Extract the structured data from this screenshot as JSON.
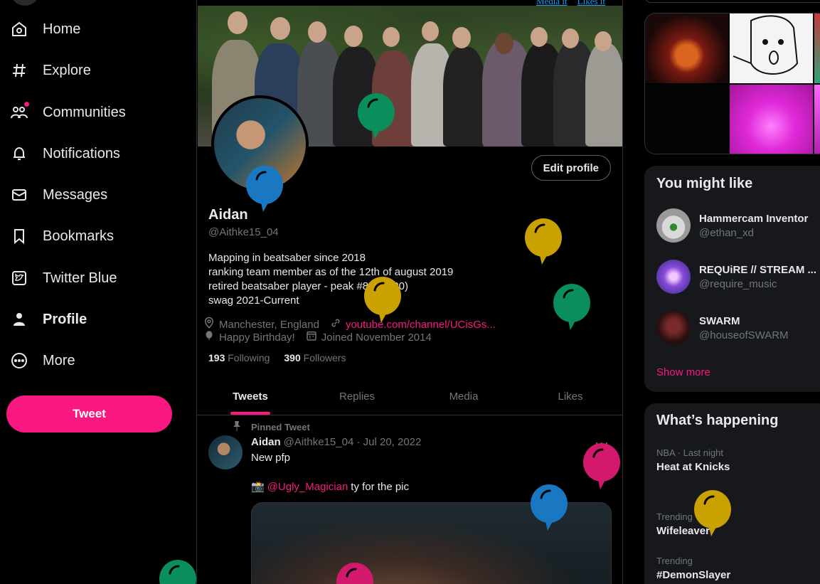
{
  "colors": {
    "accent": "#f91880",
    "bg": "#000000",
    "muted": "#71767b"
  },
  "nav": {
    "items": [
      {
        "label": "Home",
        "icon": "home-icon"
      },
      {
        "label": "Explore",
        "icon": "hashtag-icon"
      },
      {
        "label": "Communities",
        "icon": "communities-icon"
      },
      {
        "label": "Notifications",
        "icon": "bell-icon"
      },
      {
        "label": "Messages",
        "icon": "envelope-icon"
      },
      {
        "label": "Bookmarks",
        "icon": "bookmark-icon"
      },
      {
        "label": "Twitter Blue",
        "icon": "twitter-blue-icon"
      },
      {
        "label": "Profile",
        "icon": "person-icon"
      },
      {
        "label": "More",
        "icon": "more-circle-icon"
      }
    ],
    "tweet_button": "Tweet"
  },
  "top_links": {
    "media": "Media it",
    "likes": "Likes it"
  },
  "profile": {
    "name": "Aidan",
    "handle": "@Aithke15_04",
    "edit_button": "Edit profile",
    "bio": [
      "Mapping in beatsaber since 2018",
      "ranking team member as of the 12th of august 2019",
      "retired beatsaber player - peak #85 (2020)",
      "swag 2021-Current"
    ],
    "location": "Manchester, England",
    "website": "youtube.com/channel/UCisGs...",
    "birthday": "Happy Birthday!",
    "joined": "Joined November 2014",
    "following_count": "193",
    "following_label": "Following",
    "followers_count": "390",
    "followers_label": "Followers"
  },
  "tabs": [
    "Tweets",
    "Replies",
    "Media",
    "Likes"
  ],
  "pinned_tweet": {
    "pinned_label": "Pinned Tweet",
    "author": "Aidan",
    "meta": "@Aithke15_04 · Jul 20, 2022",
    "text": "New pfp",
    "camera_emoji": "📸",
    "mention": "@Ugly_Magician",
    "text_after": "ty for the pic",
    "more": "···"
  },
  "you_might_like": {
    "title": "You might like",
    "users": [
      {
        "name": "Hammercam Inventor",
        "handle": "@ethan_xd"
      },
      {
        "name": "REQUiRE // STREAM ...",
        "handle": "@require_music"
      },
      {
        "name": "SWARM",
        "handle": "@houseofSWARM"
      }
    ],
    "show_more": "Show more"
  },
  "whats_happening": {
    "title": "What’s happening",
    "trends": [
      {
        "meta": "NBA · Last night",
        "name": "Heat at Knicks"
      },
      {
        "meta": "Trending",
        "name": "Wifeleaver"
      },
      {
        "meta": "Trending",
        "name": "#DemonSlayer"
      }
    ]
  },
  "balloons": [
    {
      "color": "#0a8f5c"
    },
    {
      "color": "#1a78c2"
    },
    {
      "color": "#c9a100"
    },
    {
      "color": "#c9a100"
    },
    {
      "color": "#0a8f5c"
    },
    {
      "color": "#d3196b"
    },
    {
      "color": "#1a78c2"
    },
    {
      "color": "#c9a100"
    },
    {
      "color": "#0a8f5c"
    },
    {
      "color": "#d3196b"
    }
  ]
}
